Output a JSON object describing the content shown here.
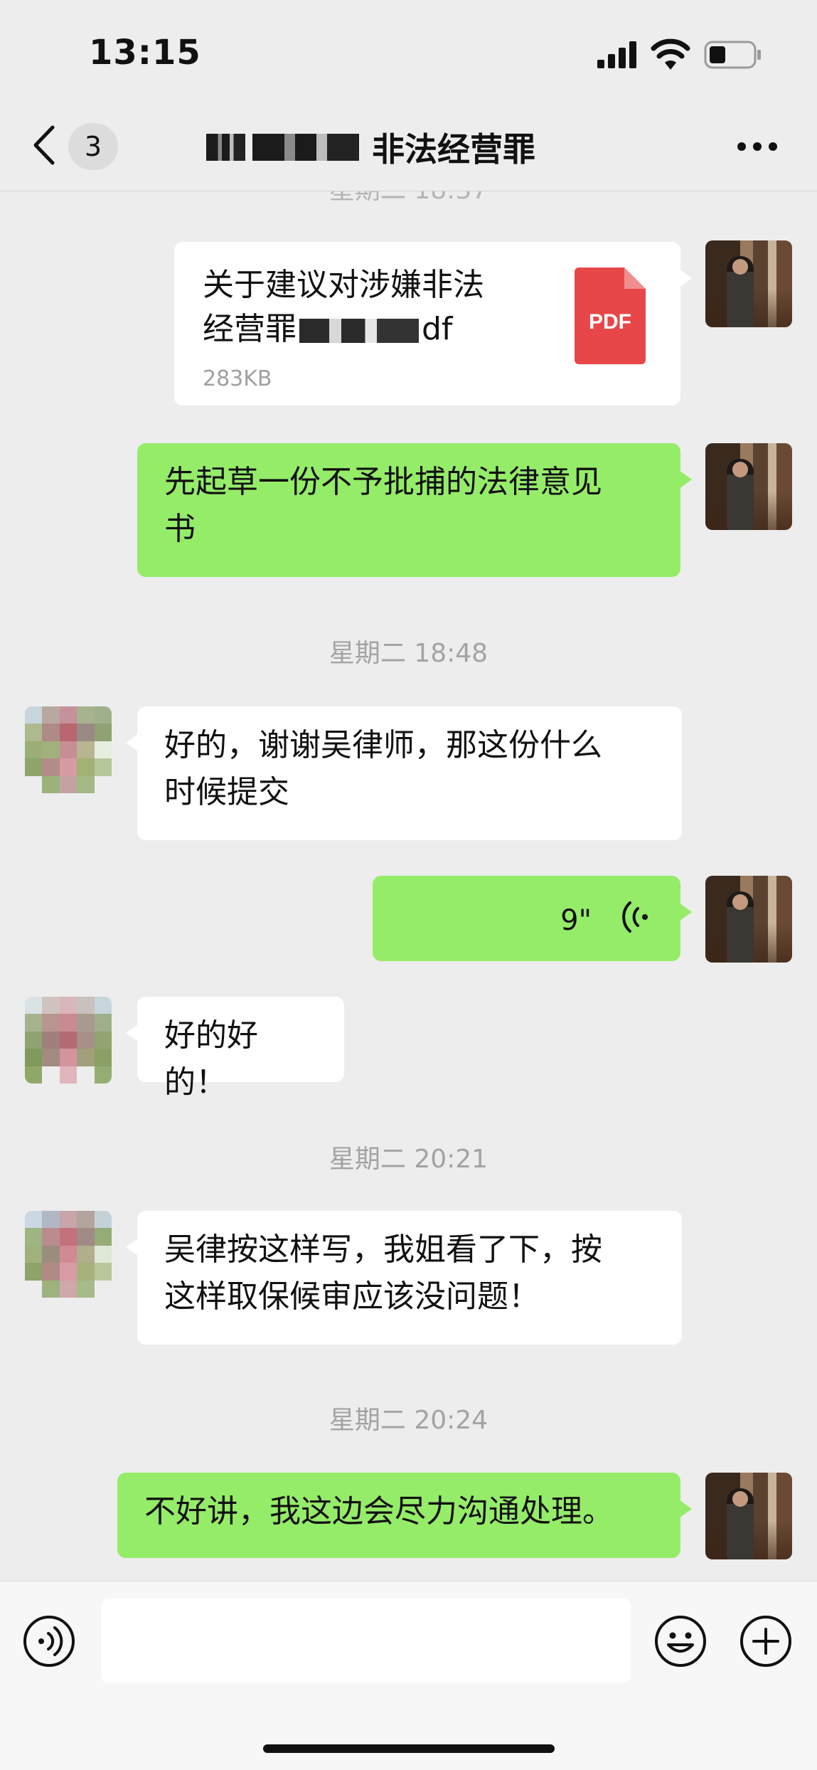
{
  "status": {
    "time": "13:15"
  },
  "nav": {
    "badge": "3",
    "title": "非法经营罪",
    "back_icon": "chevron-left-icon",
    "more_icon": "more-dots-icon"
  },
  "messages": {
    "partial_ts": "星期二 18:37",
    "file": {
      "name_line1": "关于建议对涉嫌非法",
      "name_line2_start": "经营罪",
      "name_line2_end": "df",
      "size": "283KB",
      "icon_label": "PDF"
    },
    "me1": {
      "line1": "先起草一份不予批捕的法律意见",
      "line2": "书"
    },
    "ts1": "星期二 18:48",
    "other1": {
      "line1": "好的，谢谢吴律师，那这份什么",
      "line2": "时候提交"
    },
    "voice": {
      "duration": "9\""
    },
    "other2": {
      "text": "好的好的！"
    },
    "ts2": "星期二 20:21",
    "other3": {
      "line1": "吴律按这样写，我姐看了下，按",
      "line2": "这样取保候审应该没问题！"
    },
    "ts3": "星期二 20:24",
    "me2": {
      "text": "不好讲，我这边会尽力沟通处理。"
    }
  },
  "colors": {
    "bg": "#ededed",
    "green_bubble": "#95ec69",
    "white_bubble": "#ffffff",
    "pdf_red": "#e8474a"
  },
  "inputbar": {
    "voice_icon": "voice-input-icon",
    "emoji_icon": "emoji-icon",
    "plus_icon": "plus-icon"
  }
}
